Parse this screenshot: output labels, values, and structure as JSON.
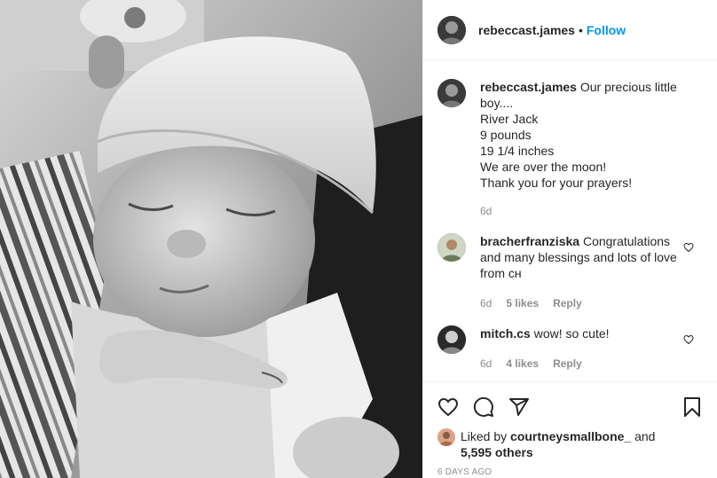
{
  "photo": {
    "alt": "Black and white photo of a sleeping newborn in a knit hat"
  },
  "header": {
    "username": "rebeccast.james",
    "separator": "•",
    "follow_label": "Follow"
  },
  "caption": {
    "username": "rebeccast.james",
    "lines": [
      "Our precious little boy....",
      "River Jack",
      "9 pounds",
      "19 1/4 inches",
      "We are over the moon!",
      "Thank you for your prayers!"
    ],
    "age": "6d"
  },
  "comments": [
    {
      "username": "bracherfranziska",
      "text": "Congratulations and many blessings and lots of love from ᴄʜ",
      "age": "6d",
      "likes": "5 likes",
      "reply": "Reply"
    },
    {
      "username": "mitch.cs",
      "text": "wow! so cute!",
      "age": "6d",
      "likes": "4 likes",
      "reply": "Reply"
    }
  ],
  "likes": {
    "prefix": "Liked by",
    "user": "courtneysmallbone_",
    "connector": "and",
    "others": "5,595 others"
  },
  "timestamp": "6 DAYS AGO"
}
